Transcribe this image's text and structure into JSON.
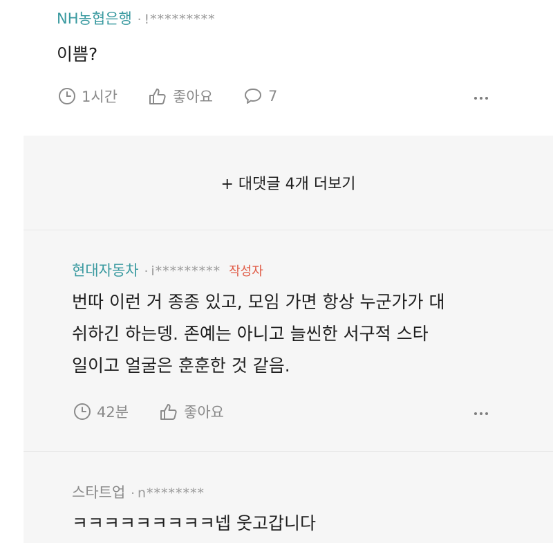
{
  "top_comment": {
    "author": "NH농협은행",
    "separator": "·",
    "masked_id": "!*********",
    "text": "이쁨?",
    "time": "1시간",
    "like_label": "좋아요",
    "reply_count": "7"
  },
  "more_replies_label": "+ 대댓글 4개 더보기",
  "replies": [
    {
      "author": "현대자동차",
      "separator": "·",
      "masked_id": "i*********",
      "badge": "작성자",
      "lines": [
        "번따 이런 거 종종 있고, 모임 가면 항상 누군가가 대",
        "쉬하긴 하는뎅. 존예는 아니고 늘씬한 서구적 스타",
        "일이고 얼굴은 훈훈한 것 같음."
      ],
      "time": "42분",
      "like_label": "좋아요"
    },
    {
      "author": "스타트업",
      "separator": "·",
      "masked_id": "n********",
      "text": "ㅋㅋㅋㅋㅋㅋㅋㅋㅋ넵 웃고갑니다"
    }
  ],
  "colors": {
    "company_accent": "#3a9aa0",
    "author_badge": "#e05a45",
    "meta_gray": "#8a8a8a",
    "reply_background": "#f6f6f6"
  },
  "icons": {
    "time": "clock-icon",
    "like": "thumbs-up-icon",
    "reply": "speech-bubble-icon",
    "more": "more-dots-icon"
  }
}
